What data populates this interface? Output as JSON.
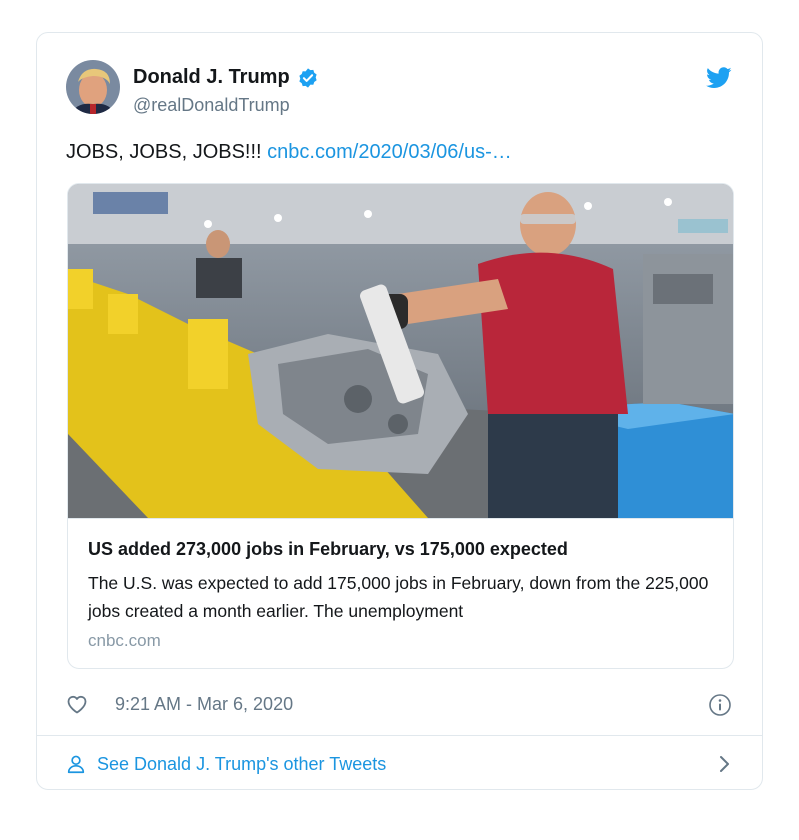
{
  "author": {
    "name": "Donald J. Trump",
    "handle": "@realDonaldTrump",
    "verified": true
  },
  "tweet": {
    "text": "JOBS, JOBS, JOBS!!!",
    "link_text": "cnbc.com/2020/03/06/us-…"
  },
  "link_card": {
    "title": "US added 273,000 jobs in February, vs 175,000 expected",
    "description": "The U.S. was expected to add 175,000 jobs in February, down from the 225,000 jobs created a month earlier. The unemployment",
    "domain": "cnbc.com",
    "image_subject": "factory-assembly-line-photo"
  },
  "meta": {
    "timestamp": "9:21 AM - Mar 6, 2020"
  },
  "footer": {
    "see_more": "See Donald J. Trump's other Tweets"
  },
  "icons": {
    "bird": "twitter-bird-icon",
    "verified": "verified-badge-icon",
    "like": "heart-icon",
    "info": "info-icon",
    "profile": "person-icon",
    "next": "chevron-right-icon"
  },
  "colors": {
    "brand": "#1da1f2",
    "link": "#1b95e0",
    "secondary_text": "#657786",
    "border": "#e1e8ed"
  }
}
